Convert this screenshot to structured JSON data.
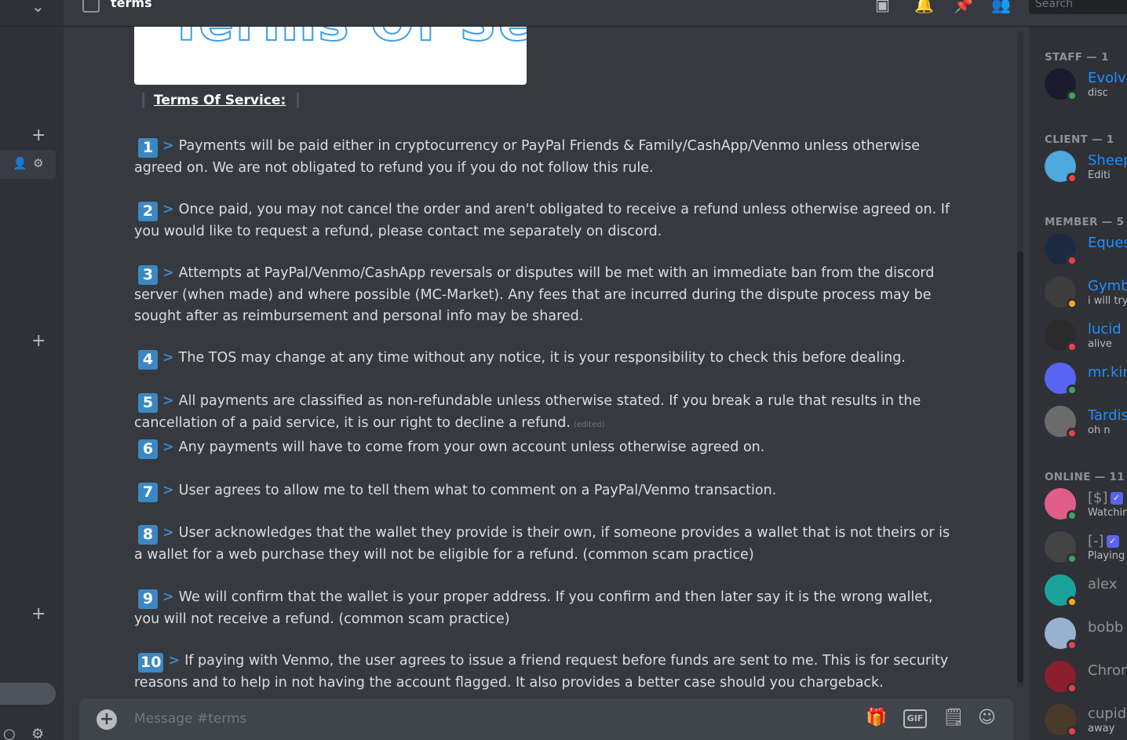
{
  "channel": {
    "name": "terms",
    "search_placeholder": "Search",
    "message_placeholder": "Message #terms"
  },
  "banner": {
    "text": "Terms Of Service"
  },
  "heading": "Terms Of Service:",
  "rules": [
    {
      "num": "1",
      "text": "Payments will be paid either in cryptocurrency or PayPal Friends & Family/CashApp/Venmo unless otherwise agreed on. We are not obligated to refund you if you do not follow this rule."
    },
    {
      "num": "2",
      "text": "Once paid, you may not cancel the order and aren't obligated to receive a refund unless otherwise agreed on. If you would like to request a refund, please contact me separately on discord."
    },
    {
      "num": "3",
      "text": "Attempts at PayPal/Venmo/CashApp reversals or disputes will be met with an immediate ban from the discord server (when made) and where possible (MC-Market). Any fees that are incurred during the dispute process may be sought after as reimbursement and personal info may be shared."
    },
    {
      "num": "4",
      "text": "The TOS may change at any time without any notice, it is your responsibility to check this before dealing."
    },
    {
      "num": "5",
      "text": "All payments are classified as non-refundable unless otherwise stated. If you break a rule that results in the cancellation of a paid service, it is our right to decline a refund.",
      "edited": "(edited)"
    },
    {
      "num": "6",
      "text": "Any payments will have to come from your own account unless otherwise agreed on."
    },
    {
      "num": "7",
      "text": "User agrees to allow me to tell them what to comment on a PayPal/Venmo transaction."
    },
    {
      "num": "8",
      "text": "User acknowledges that the wallet they provide is their own, if someone provides a wallet that is not theirs or is a wallet for a web purchase they will not be eligible for a refund. (common scam practice)"
    },
    {
      "num": "9",
      "text": "We will confirm that the wallet is your proper address. If you confirm and then later say it is the wrong wallet, you will not receive a refund. (common scam practice)"
    },
    {
      "num": "10",
      "text": "If paying with Venmo, the user agrees to issue a friend request before funds are sent to me. This is for security reasons and to help in not having the account flagged. It also provides a better case should you chargeback."
    }
  ],
  "members": {
    "sections": [
      {
        "label": "STAFF — 1"
      },
      {
        "label": "CLIENT — 1"
      },
      {
        "label": "MEMBER — 5"
      },
      {
        "label": "ONLINE — 11"
      }
    ],
    "list": [
      {
        "name": "Evolve",
        "sub": "disc",
        "color": "#1e90ff",
        "status": "online",
        "avatar_color": "#1a1a2e"
      },
      {
        "name": "Sheep",
        "sub": "Editi",
        "color": "#1e90ff",
        "status": "dnd",
        "avatar_color": "#4ea8de"
      },
      {
        "name": "Eques",
        "sub": "",
        "color": "#1e90ff",
        "status": "dnd",
        "avatar_color": "#1b2a41"
      },
      {
        "name": "Gymb",
        "sub": "i will try",
        "color": "#1e90ff",
        "status": "idle",
        "avatar_color": "#3d3d3d"
      },
      {
        "name": "lucid",
        "sub": "alive",
        "color": "#1e90ff",
        "status": "dnd",
        "avatar_color": "#2b2b2b"
      },
      {
        "name": "mr.kin",
        "sub": "",
        "color": "#1e90ff",
        "status": "online",
        "avatar_color": "#5865f2"
      },
      {
        "name": "Tardis",
        "sub": "oh n",
        "color": "#1e90ff",
        "status": "dnd",
        "avatar_color": "#6b6b6b"
      },
      {
        "name": "[$]",
        "sub": "Watchin",
        "color": "#8e9297",
        "status": "online",
        "avatar_color": "#e05d8a"
      },
      {
        "name": "[-]",
        "sub": "Playing",
        "color": "#8e9297",
        "status": "online",
        "avatar_color": "#444"
      },
      {
        "name": "alex",
        "sub": "",
        "color": "#8e9297",
        "status": "idle",
        "avatar_color": "#1aa39a"
      },
      {
        "name": "bobb",
        "sub": "",
        "color": "#8e9297",
        "status": "dnd",
        "avatar_color": "#9ab0d0"
      },
      {
        "name": "Chron",
        "sub": "",
        "color": "#8e9297",
        "status": "dnd",
        "avatar_color": "#8b1e2d"
      },
      {
        "name": "cupid",
        "sub": "away",
        "color": "#8e9297",
        "status": "dnd",
        "avatar_color": "#4a3a2a"
      }
    ]
  }
}
